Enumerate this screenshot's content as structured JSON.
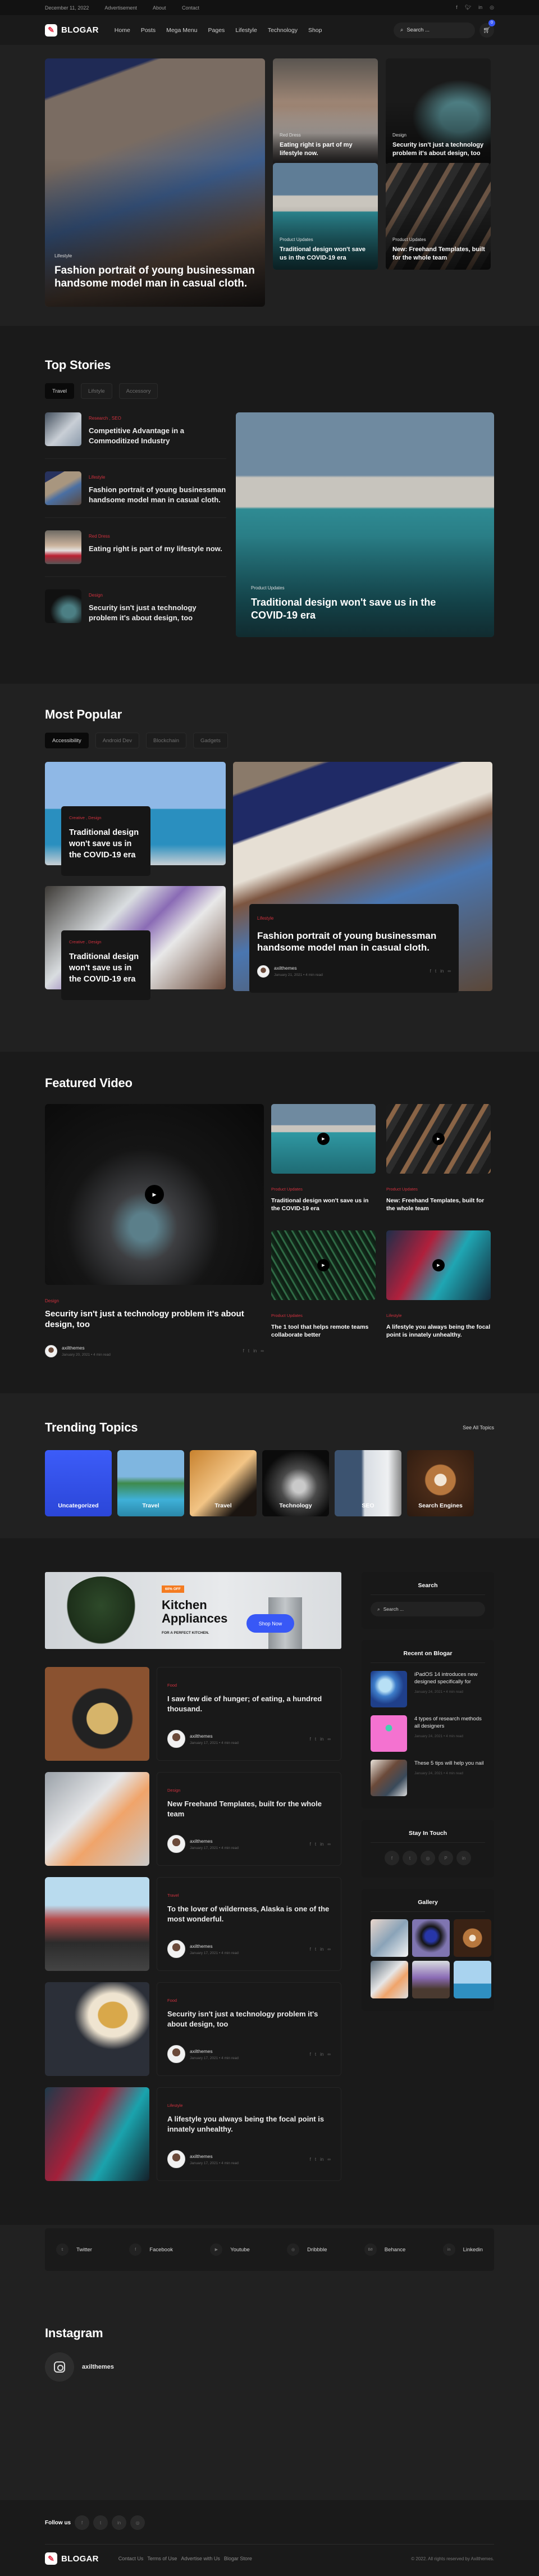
{
  "topbar": {
    "date": "December 11, 2022",
    "links": [
      "Advertisement",
      "About",
      "Contact"
    ],
    "social": [
      "facebook-icon",
      "twitter-icon",
      "linkedin-icon",
      "instagram-icon"
    ]
  },
  "header": {
    "logo_text": "BLOGAR",
    "nav": [
      "Home",
      "Posts",
      "Mega Menu",
      "Pages",
      "Lifestyle",
      "Technology",
      "Shop"
    ],
    "search_placeholder": "Search ...",
    "cart_count": "0",
    "accent": "#3858f6"
  },
  "hero": {
    "main": {
      "category": "Lifestyle",
      "title": "Fashion portrait of young businessman handsome model man in casual cloth."
    },
    "cards": [
      {
        "category": "Red Dress",
        "title": "Eating right is part of my lifestyle now."
      },
      {
        "category": "Design",
        "title": "Security isn't just a technology problem it's about design, too"
      },
      {
        "category": "Product Updates",
        "title": "Traditional design won't save us in the COVID-19 era"
      },
      {
        "category": "Product Updates",
        "title": "New: Freehand Templates, built for the whole team"
      }
    ]
  },
  "top_stories": {
    "title": "Top Stories",
    "tabs": [
      "Travel",
      "Lifstyle",
      "Accessory"
    ],
    "active_tab": "Travel",
    "items": [
      {
        "category": "Research ,  SEO",
        "title": "Competitive Advantage in a Commoditized Industry"
      },
      {
        "category": "Lifestyle",
        "title": "Fashion portrait of young businessman handsome model man in casual cloth."
      },
      {
        "category": "Red Dress",
        "title": "Eating right is part of my lifestyle now."
      },
      {
        "category": "Design",
        "title": "Security isn't just a technology problem it's about design, too"
      }
    ],
    "feature": {
      "category": "Product Updates",
      "title": "Traditional design won't save us in the COVID-19 era"
    }
  },
  "most_popular": {
    "title": "Most Popular",
    "tabs": [
      "Accessibility",
      "Android Dev",
      "Blockchain",
      "Gadgets"
    ],
    "active_tab": "Accessibility",
    "left": [
      {
        "category": "Creative ,  Design",
        "title": "Traditional design won't save us in the COVID-19 era"
      },
      {
        "category": "Creative ,  Design",
        "title": "Traditional design won't save us in the COVID-19 era"
      }
    ],
    "right": {
      "category": "Lifestyle",
      "title": "Fashion portrait of young businessman handsome model man in casual cloth.",
      "author": "axilthemes",
      "meta": "January 21, 2021  •  4 min read"
    }
  },
  "featured_video": {
    "title": "Featured Video",
    "main": {
      "category": "Design",
      "title": "Security isn't just a technology problem it's about design, too",
      "author": "axilthemes",
      "meta": "January 20, 2021  •  4 min read"
    },
    "items": [
      {
        "category": "Product Updates",
        "title": "Traditional design won't save us in the COVID-19 era"
      },
      {
        "category": "Product Updates",
        "title": "New: Freehand Templates, built for the whole team"
      },
      {
        "category": "Product Updates",
        "title": "The 1 tool that helps remote teams collaborate better"
      },
      {
        "category": "Lifestyle",
        "title": "A lifestyle you always being the focal point is innately unhealthy."
      }
    ]
  },
  "trending": {
    "title": "Trending Topics",
    "see_all": "See All Topics",
    "topics": [
      "Uncategorized",
      "Travel",
      "Travel",
      "Technology",
      "SEO",
      "Search Engines"
    ]
  },
  "banner": {
    "badge": "60% OFF",
    "title_line1": "Kitchen",
    "title_line2": "Appliances",
    "subtitle": "FOR A PERFECT KITCHEN.",
    "button": "Shop Now"
  },
  "posts": [
    {
      "category": "Food",
      "title": "I saw few die of hunger; of eating, a hundred thousand.",
      "author": "axilthemes",
      "meta": "January 17, 2021  •  4 min read"
    },
    {
      "category": "Design",
      "title": "New Freehand Templates, built for the whole team",
      "author": "axilthemes",
      "meta": "January 17, 2021  •  4 min read"
    },
    {
      "category": "Travel",
      "title": "To the lover of wilderness, Alaska is one of the most wonderful.",
      "author": "axilthemes",
      "meta": "January 17, 2021  •  4 min read"
    },
    {
      "category": "Food",
      "title": "Security isn't just a technology problem it's about design, too",
      "author": "axilthemes",
      "meta": "January 17, 2021  •  4 min read"
    },
    {
      "category": "Lifestyle",
      "title": "A lifestyle you always being the focal point is innately unhealthy.",
      "author": "axilthemes",
      "meta": "January 17, 2021  •  4 min read"
    }
  ],
  "sidebar": {
    "search_title": "Search",
    "search_placeholder": "Search ...",
    "recent_title": "Recent on Blogar",
    "recent": [
      {
        "title": "iPadOS 14 introduces new designed specifically for",
        "meta": "January 24, 2021  •  4 min read"
      },
      {
        "title": "4 types of research methods all designers",
        "meta": "January 24, 2021  •  4 min read"
      },
      {
        "title": "These 5 tips will help you nail",
        "meta": "January 24, 2021  •  4 min read"
      }
    ],
    "touch_title": "Stay In Touch",
    "touch_icons": [
      "facebook-icon",
      "twitter-icon",
      "instagram-icon",
      "pinterest-icon",
      "linkedin-icon"
    ],
    "gallery_title": "Gallery"
  },
  "social_band": [
    {
      "icon": "twitter-icon",
      "glyph": "𝕥",
      "label": "Twitter"
    },
    {
      "icon": "facebook-icon",
      "glyph": "f",
      "label": "Facebook"
    },
    {
      "icon": "youtube-icon",
      "glyph": "▶",
      "label": "Youtube"
    },
    {
      "icon": "dribbble-icon",
      "glyph": "◎",
      "label": "Dribbble"
    },
    {
      "icon": "behance-icon",
      "glyph": "Bē",
      "label": "Behance"
    },
    {
      "icon": "linkedin-icon",
      "glyph": "in",
      "label": "Linkedin"
    }
  ],
  "instagram": {
    "title": "Instagram",
    "handle": "axilthemes"
  },
  "footer": {
    "follow_label": "Follow us",
    "logo_text": "BLOGAR",
    "links": [
      "Contact Us",
      "Terms of Use",
      "Advertise with Us",
      "Blogar Store"
    ],
    "copyright": "© 2022. All rights reserved by Axilthemes."
  }
}
